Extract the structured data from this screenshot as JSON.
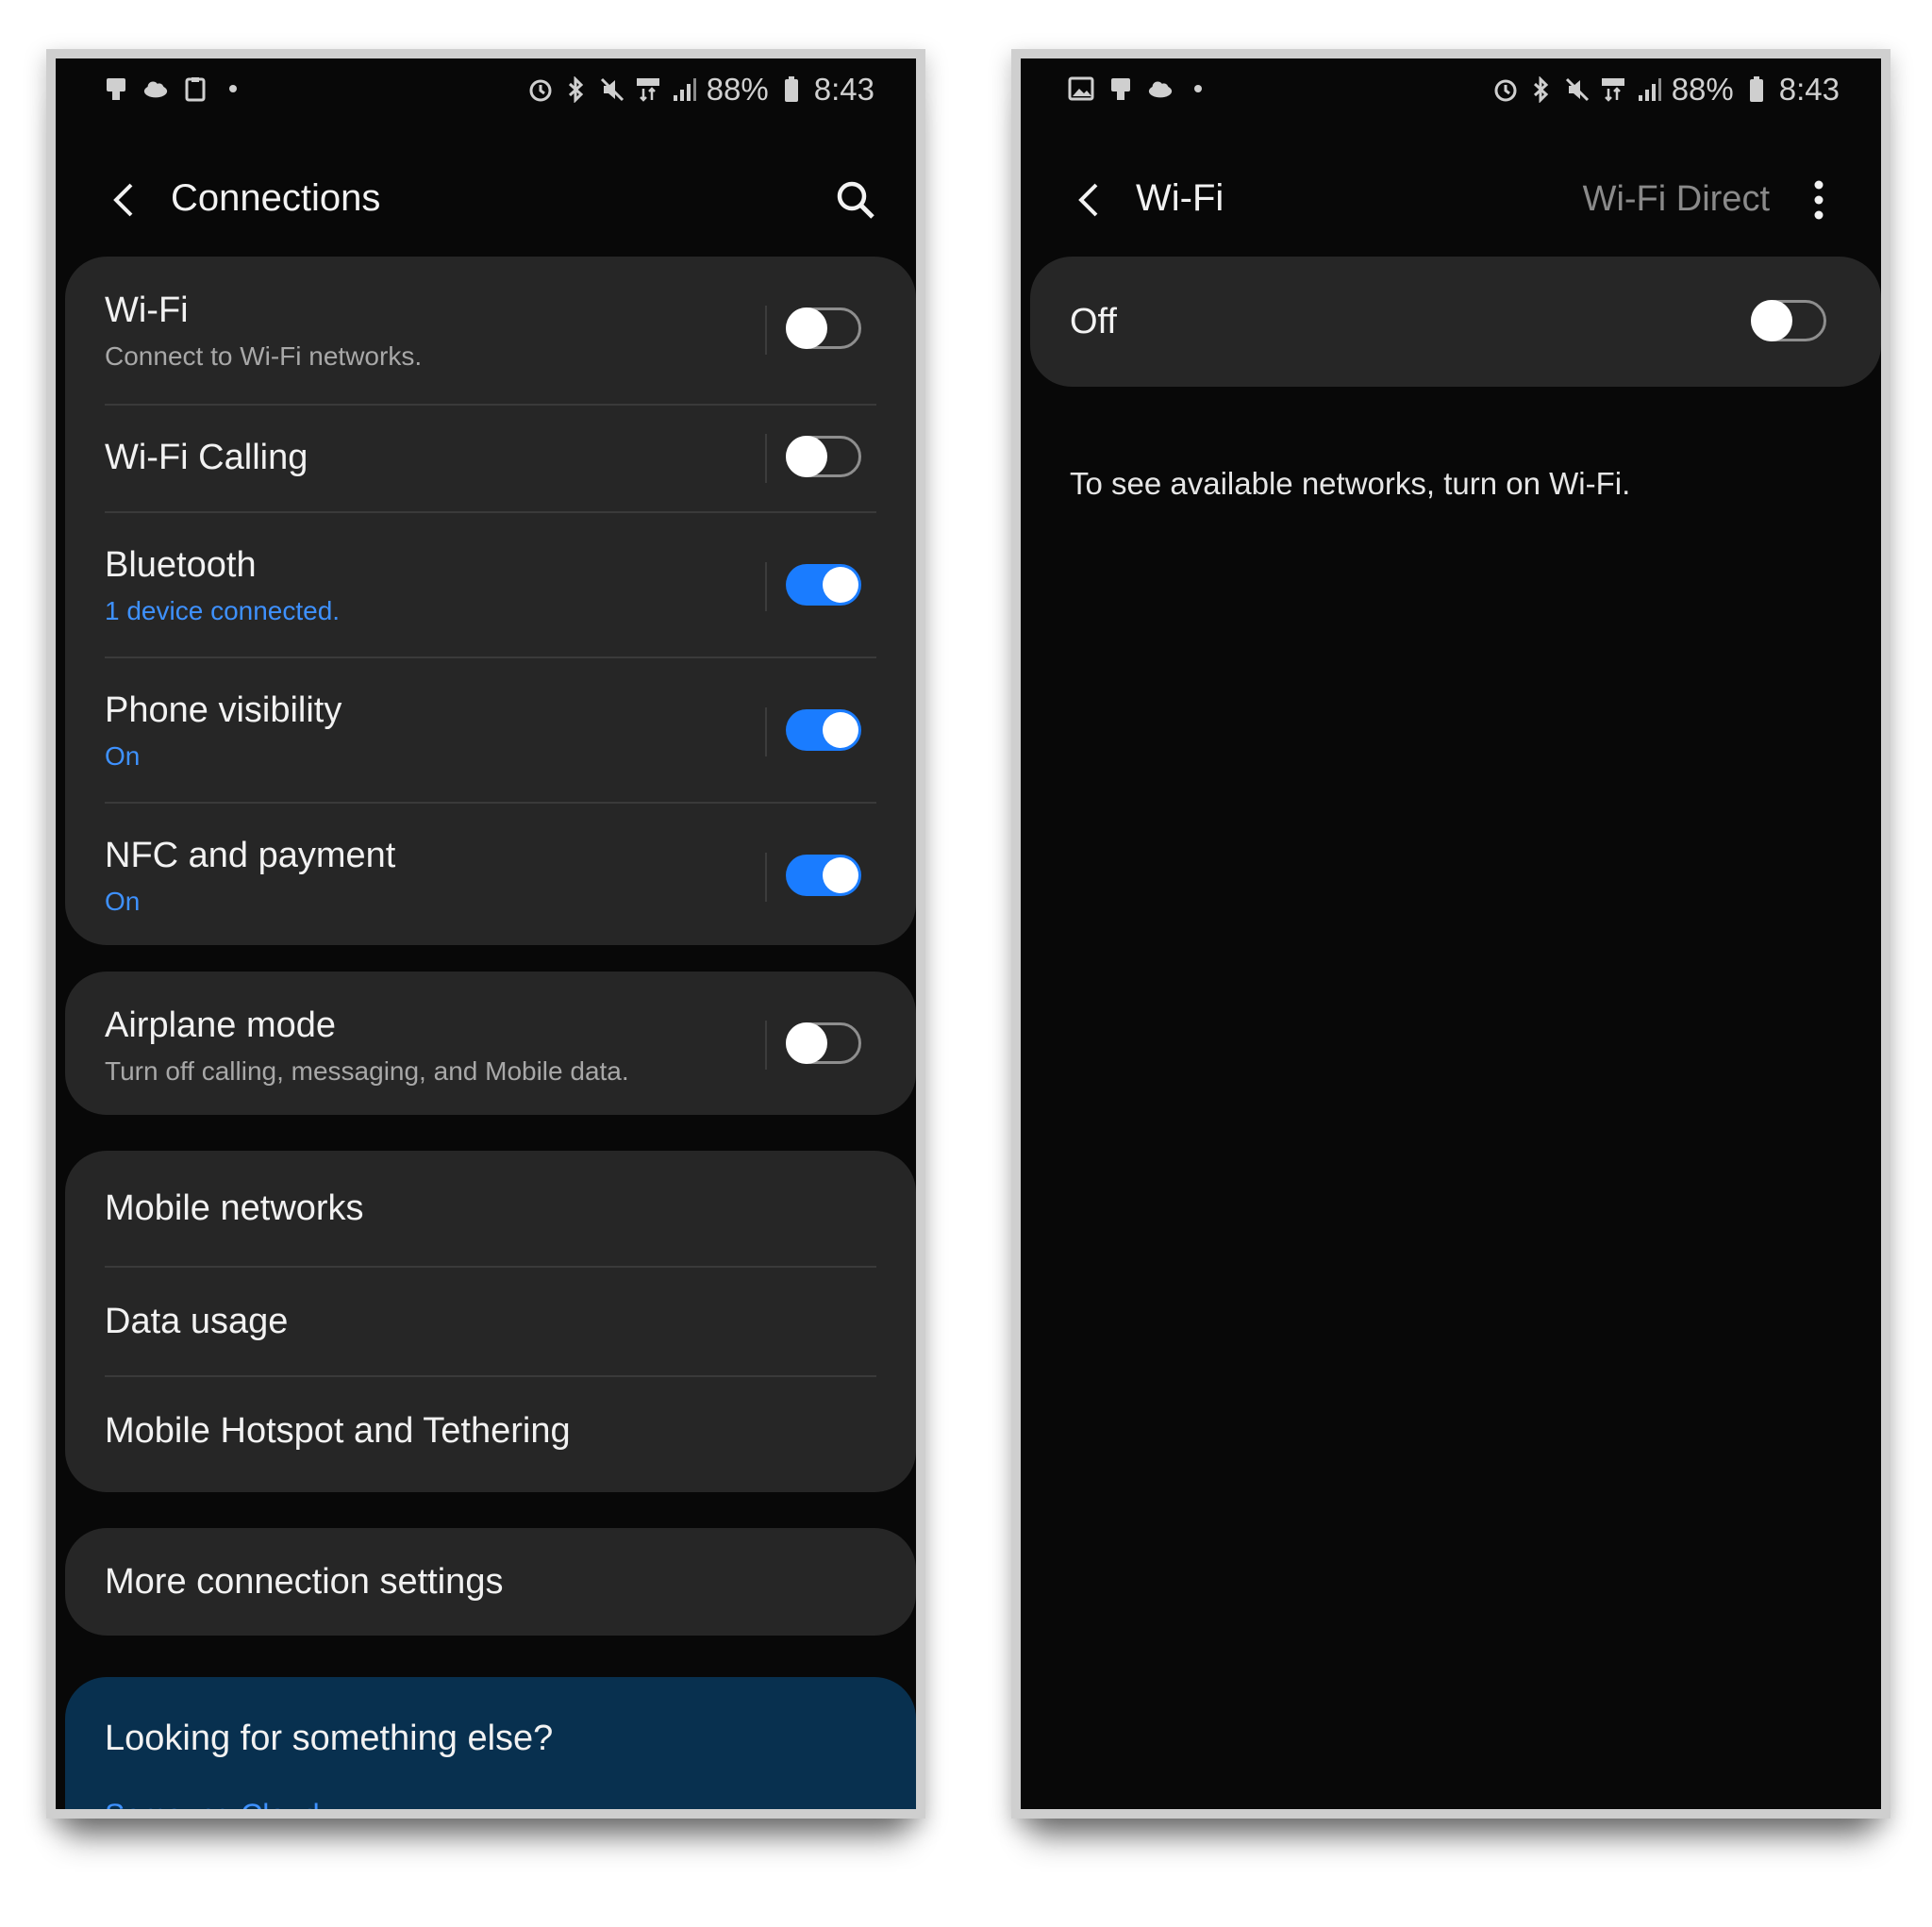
{
  "status_bar": {
    "battery": "88%",
    "time": "8:43"
  },
  "connections": {
    "title": "Connections",
    "items": [
      {
        "label": "Wi-Fi",
        "sub": "Connect to Wi-Fi networks.",
        "on": false
      },
      {
        "label": "Wi-Fi Calling",
        "sub": "",
        "on": false
      },
      {
        "label": "Bluetooth",
        "sub": "1 device connected.",
        "on": true
      },
      {
        "label": "Phone visibility",
        "sub": "On",
        "on": true
      },
      {
        "label": "NFC and payment",
        "sub": "On",
        "on": true
      }
    ],
    "airplane": {
      "label": "Airplane mode",
      "sub": "Turn off calling, messaging, and Mobile data.",
      "on": false
    },
    "links": [
      "Mobile networks",
      "Data usage",
      "Mobile Hotspot and Tethering"
    ],
    "more": "More connection settings",
    "help": {
      "title": "Looking for something else?",
      "link": "Samsung Cloud"
    }
  },
  "wifi": {
    "title": "Wi-Fi",
    "wifi_direct": "Wi-Fi Direct",
    "master_label": "Off",
    "master_on": false,
    "message": "To see available networks, turn on Wi-Fi."
  },
  "colors": {
    "accent": "#1a7cff",
    "link_blue": "#3e91ff",
    "card": "#262626",
    "background": "#080808"
  }
}
